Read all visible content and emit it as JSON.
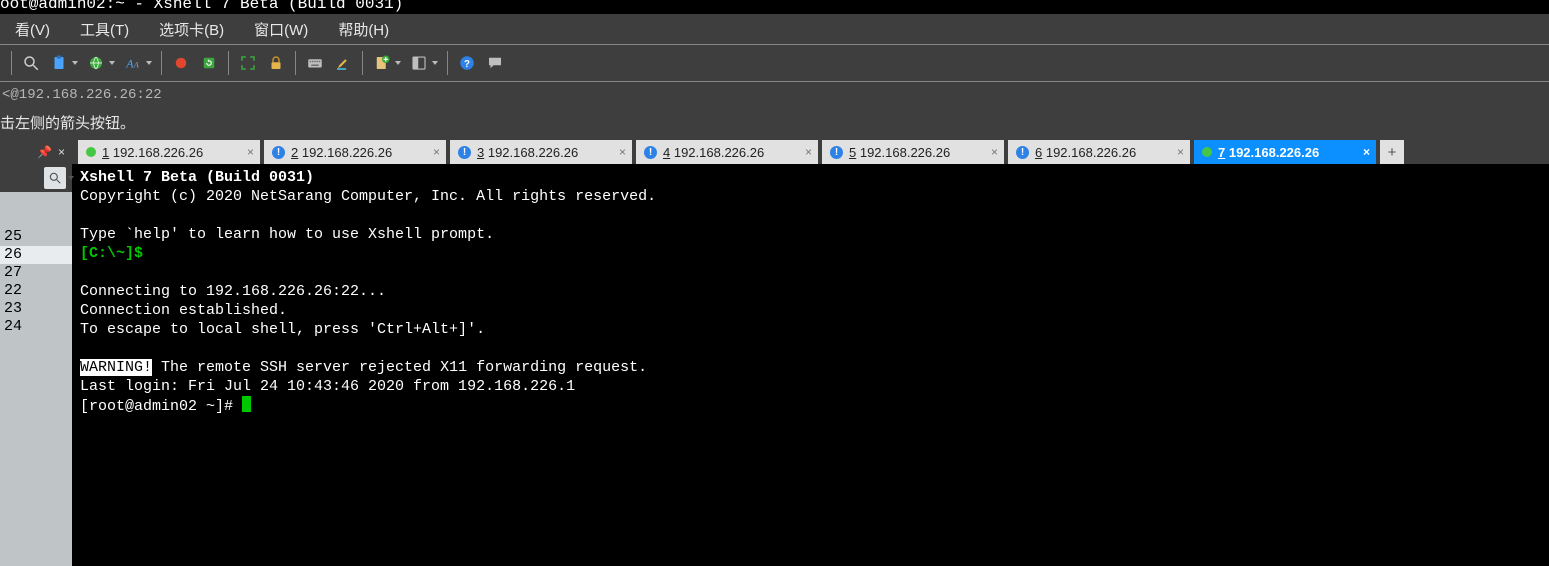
{
  "title": "oot@admin02:~ - Xshell 7 Beta (Build 0031)",
  "menu": {
    "view": "看(V)",
    "tools": "工具(T)",
    "tabs": "选项卡(B)",
    "window": "窗口(W)",
    "help": "帮助(H)"
  },
  "address": "<@192.168.226.26:22",
  "hint": "击左侧的箭头按钮。",
  "sidebar_items": [
    {
      "n": "25",
      "hl": false
    },
    {
      "n": "26",
      "hl": true
    },
    {
      "n": "27",
      "hl": false
    },
    {
      "n": "",
      "hl": false
    },
    {
      "n": "22",
      "hl": false
    },
    {
      "n": "23",
      "hl": false
    },
    {
      "n": "24",
      "hl": false
    }
  ],
  "pin": "📌",
  "close": "×",
  "tabs": [
    {
      "idx": "1",
      "idx_u": "1",
      "label": "192.168.226.26",
      "kind": "dot",
      "color": "#45c745",
      "active": false
    },
    {
      "idx": "2",
      "idx_u": "2",
      "label": "192.168.226.26",
      "kind": "excl",
      "active": false
    },
    {
      "idx": "3",
      "idx_u": "3",
      "label": "192.168.226.26",
      "kind": "excl",
      "active": false
    },
    {
      "idx": "4",
      "idx_u": "4",
      "label": "192.168.226.26",
      "kind": "excl",
      "active": false
    },
    {
      "idx": "5",
      "idx_u": "5",
      "label": "192.168.226.26",
      "kind": "excl",
      "active": false
    },
    {
      "idx": "6",
      "idx_u": "6",
      "label": "192.168.226.26",
      "kind": "excl",
      "active": false
    },
    {
      "idx": "7",
      "idx_u": "7",
      "label": "192.168.226.26",
      "kind": "dot",
      "color": "#45c745",
      "active": true
    }
  ],
  "add": "+",
  "term": {
    "l1": "Xshell 7 Beta (Build 0031)",
    "l2": "Copyright (c) 2020 NetSarang Computer, Inc. All rights reserved.",
    "l4": "Type `help' to learn how to use Xshell prompt.",
    "prompt1": "[C:\\~]$",
    "l7": "Connecting to 192.168.226.26:22...",
    "l8": "Connection established.",
    "l9": "To escape to local shell, press 'Ctrl+Alt+]'.",
    "warn": "WARNING!",
    "l11": " The remote SSH server rejected X11 forwarding request.",
    "l12": "Last login: Fri Jul 24 10:43:46 2020 from 192.168.226.1",
    "prompt2": "[root@admin02 ~]# "
  }
}
